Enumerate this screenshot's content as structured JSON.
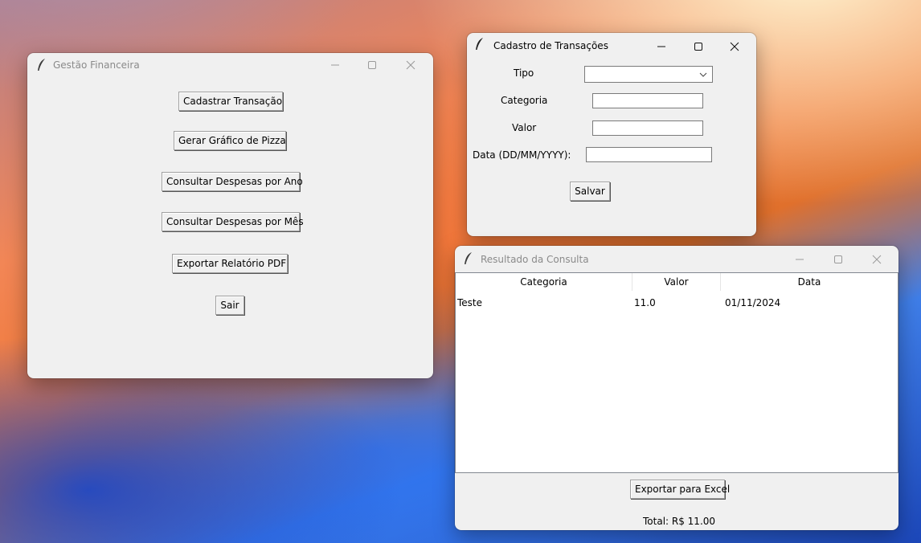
{
  "main_window": {
    "title": "Gestão Financeira",
    "buttons": {
      "cadastrar": "Cadastrar Transação",
      "grafico": "Gerar Gráfico de Pizza",
      "despesas_ano": "Consultar Despesas por Ano",
      "despesas_mes": "Consultar Despesas por Mês",
      "exportar_pdf": "Exportar Relatório PDF",
      "sair": "Sair"
    }
  },
  "cadastro_window": {
    "title": "Cadastro de Transações",
    "fields": {
      "tipo_label": "Tipo",
      "tipo_value": "",
      "categoria_label": "Categoria",
      "categoria_value": "",
      "valor_label": "Valor",
      "valor_value": "",
      "data_label": "Data (DD/MM/YYYY):",
      "data_value": ""
    },
    "save_label": "Salvar"
  },
  "resultado_window": {
    "title": "Resultado da Consulta",
    "columns": [
      "Categoria",
      "Valor",
      "Data"
    ],
    "rows": [
      {
        "categoria": "Teste",
        "valor": "11.0",
        "data": "01/11/2024"
      }
    ],
    "export_label": "Exportar para Excel",
    "total": "Total: R$ 11.00"
  },
  "icons": {
    "app": "feather-icon",
    "minimize": "minimize-icon",
    "maximize": "maximize-icon",
    "close": "close-icon",
    "dropdown": "chevron-down-icon"
  }
}
